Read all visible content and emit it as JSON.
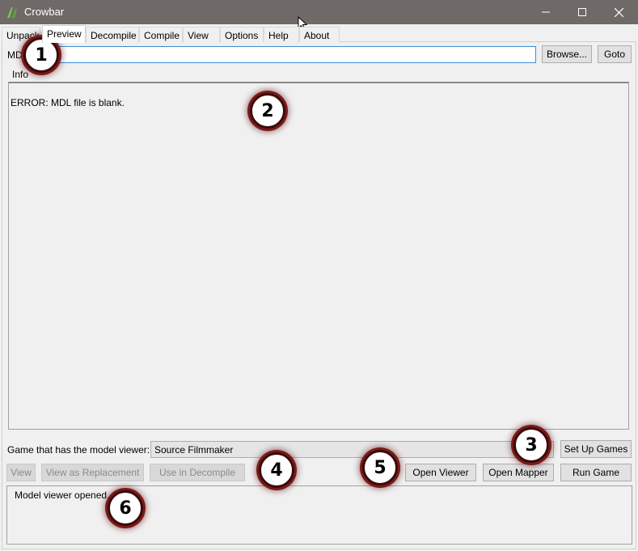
{
  "window": {
    "title": "Crowbar",
    "icons": {
      "app": "crowbar-logo-icon",
      "minimize": "minimize-icon",
      "maximize": "maximize-icon",
      "close": "close-icon"
    }
  },
  "tabs": [
    {
      "label": "Unpack"
    },
    {
      "label": "Preview",
      "active": true
    },
    {
      "label": "Decompile"
    },
    {
      "label": "Compile"
    },
    {
      "label": "View"
    },
    {
      "label": "Options"
    },
    {
      "label": "Help"
    },
    {
      "label": "About"
    }
  ],
  "mdl": {
    "label": "MDL file:",
    "value": "",
    "browse_label": "Browse...",
    "goto_label": "Goto"
  },
  "info": {
    "label": "Info",
    "text": "ERROR: MDL file is blank."
  },
  "game": {
    "label": "Game that has the model viewer:",
    "selected": "Source Filmmaker",
    "setup_label": "Set Up Games"
  },
  "actions": {
    "view_label": "View",
    "view_replacement_label": "View as Replacement",
    "use_decompile_label": "Use in Decompile",
    "open_viewer_label": "Open Viewer",
    "open_mapper_label": "Open Mapper",
    "run_game_label": "Run Game"
  },
  "status": {
    "text": "Model viewer opened."
  },
  "annotations": [
    "1",
    "2",
    "3",
    "4",
    "5",
    "6"
  ],
  "colors": {
    "titlebar": "#6f6968",
    "input_border": "#3a8fd4",
    "badge_ring": "#7a1a1a"
  }
}
